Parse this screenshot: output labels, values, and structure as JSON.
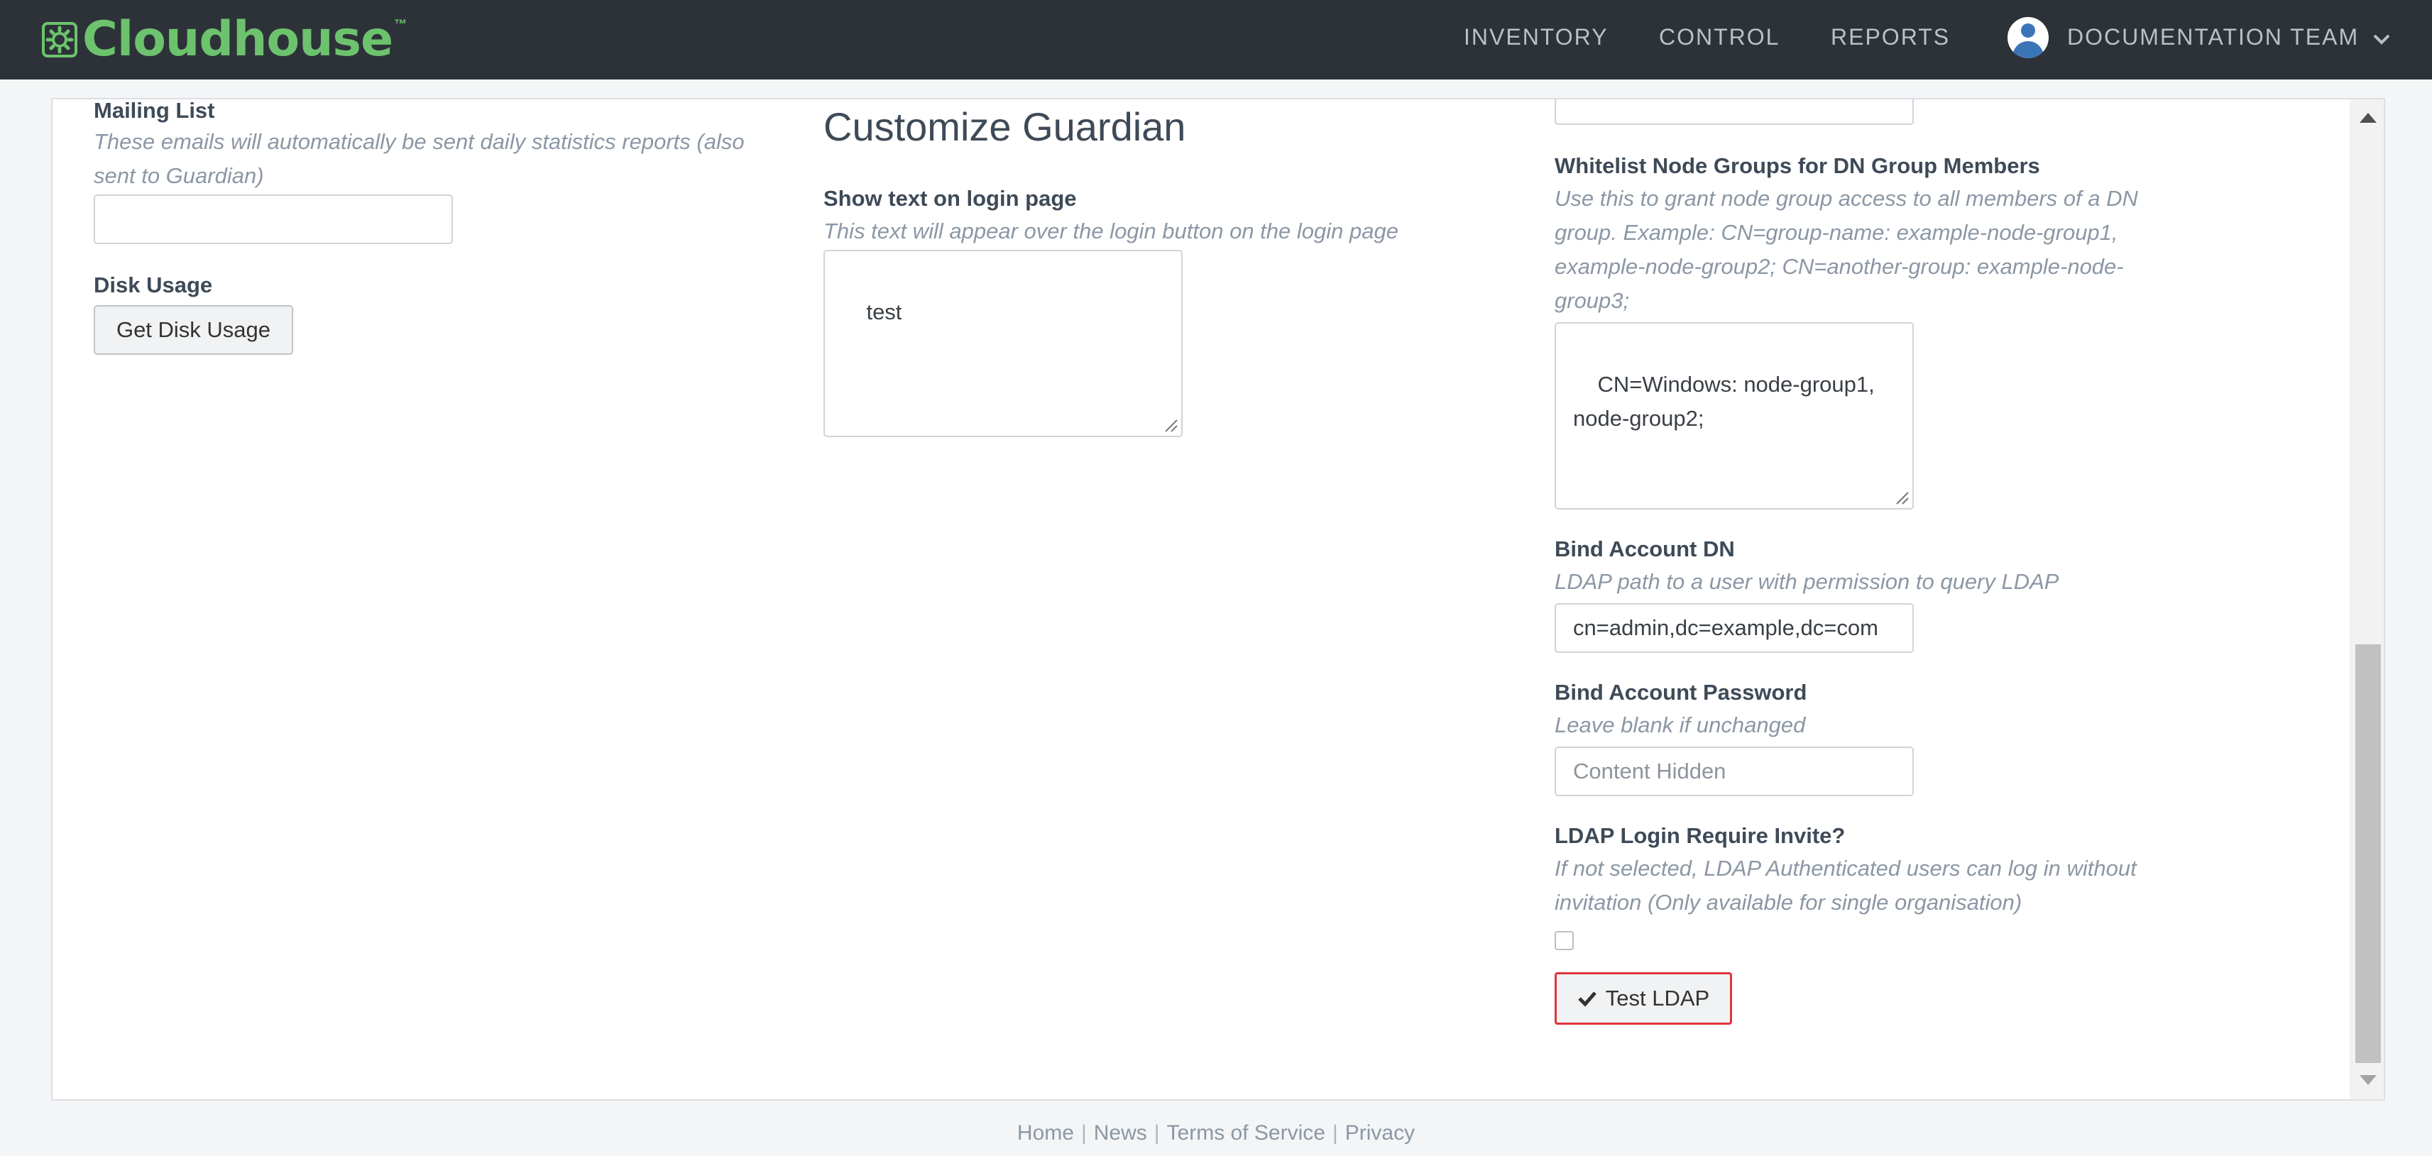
{
  "brand": {
    "name": "Cloudhouse",
    "tm": "™",
    "color": "#6dc36d"
  },
  "nav": {
    "links": [
      "INVENTORY",
      "CONTROL",
      "REPORTS"
    ],
    "team": "DOCUMENTATION TEAM"
  },
  "left": {
    "mailing_list": {
      "label": "Mailing List",
      "hint": "These emails will automatically be sent daily statistics reports (also sent to Guardian)",
      "value": ""
    },
    "disk_usage": {
      "label": "Disk Usage",
      "button": "Get Disk Usage"
    }
  },
  "middle": {
    "heading": "Customize Guardian",
    "login_text": {
      "label": "Show text on login page",
      "hint": "This text will appear over the login button on the login page",
      "value": "test"
    }
  },
  "right": {
    "top_input_value": "",
    "whitelist": {
      "label": "Whitelist Node Groups for DN Group Members",
      "hint": "Use this to grant node group access to all members of a DN group. Example: CN=group-name: example-node-group1, example-node-group2; CN=another-group: example-node-group3;",
      "value": "CN=Windows: node-group1,\nnode-group2;"
    },
    "bind_dn": {
      "label": "Bind Account DN",
      "hint": "LDAP path to a user with permission to query LDAP",
      "value": "cn=admin,dc=example,dc=com"
    },
    "bind_password": {
      "label": "Bind Account Password",
      "hint": "Leave blank if unchanged",
      "placeholder": "Content Hidden"
    },
    "ldap_invite": {
      "label": "LDAP Login Require Invite?",
      "hint": "If not selected, LDAP Authenticated users can log in without invitation (Only available for single organisation)",
      "checked": false
    },
    "test_button": "Test LDAP",
    "test_button_icon": "check-icon",
    "test_button_border": "#e0343c"
  },
  "footer": {
    "links": [
      "Home",
      "News",
      "Terms of Service",
      "Privacy"
    ],
    "separator": "|"
  }
}
